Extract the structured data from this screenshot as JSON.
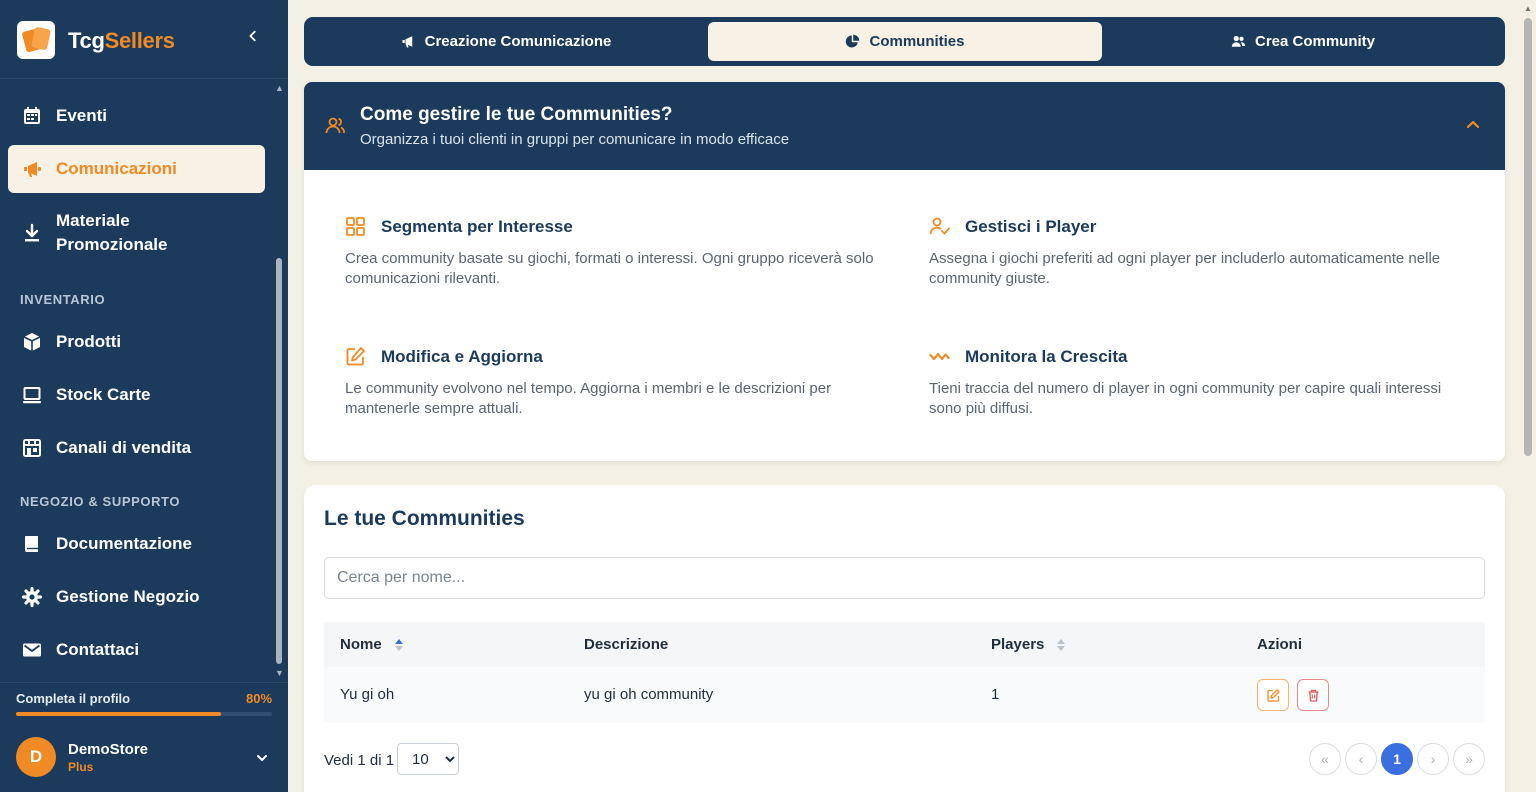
{
  "brand": {
    "name_part1": "Tcg",
    "name_part2": "Sellers"
  },
  "sidebar": {
    "collapse_icon": "chevron-left-icon",
    "items": [
      {
        "label": "Eventi",
        "icon": "calendar-icon",
        "active": false
      },
      {
        "label": "Comunicazioni",
        "icon": "megaphone-icon",
        "active": true
      },
      {
        "label": "Materiale Promozionale",
        "icon": "download-icon",
        "active": false
      },
      {
        "label": "Prodotti",
        "icon": "box-icon",
        "active": false
      },
      {
        "label": "Stock Carte",
        "icon": "monitor-icon",
        "active": false
      },
      {
        "label": "Canali di vendita",
        "icon": "store-icon",
        "active": false
      },
      {
        "label": "Documentazione",
        "icon": "book-icon",
        "active": false
      },
      {
        "label": "Gestione Negozio",
        "icon": "gear-icon",
        "active": false
      },
      {
        "label": "Contattaci",
        "icon": "mail-icon",
        "active": false
      }
    ],
    "sections": {
      "inventory": "INVENTARIO",
      "shop_support": "NEGOZIO & SUPPORTO"
    },
    "profile_progress": {
      "label": "Completa il profilo",
      "value_text": "80%",
      "fraction": 0.8
    },
    "user": {
      "initial": "D",
      "name": "DemoStore",
      "plan": "Plus"
    }
  },
  "tabs": [
    {
      "label": "Creazione Comunicazione",
      "icon": "megaphone-icon",
      "active": false
    },
    {
      "label": "Communities",
      "icon": "pie-chart-icon",
      "active": true
    },
    {
      "label": "Crea Community",
      "icon": "users-icon",
      "active": false
    }
  ],
  "info": {
    "title": "Come gestire le tue Communities?",
    "subtitle": "Organizza i tuoi clienti in gruppi per comunicare in modo efficace",
    "features": [
      {
        "title": "Segmenta per Interesse",
        "icon": "grid-icon",
        "desc": "Crea community basate su giochi, formati o interessi. Ogni gruppo riceverà solo comunicazioni rilevanti."
      },
      {
        "title": "Gestisci i Player",
        "icon": "user-check-icon",
        "desc": "Assegna i giochi preferiti ad ogni player per includerlo automaticamente nelle community giuste."
      },
      {
        "title": "Modifica e Aggiorna",
        "icon": "edit-icon",
        "desc": "Le community evolvono nel tempo. Aggiorna i membri e le descrizioni per mantenerle sempre attuali."
      },
      {
        "title": "Monitora la Crescita",
        "icon": "activity-icon",
        "desc": "Tieni traccia del numero di player in ogni community per capire quali interessi sono più diffusi."
      }
    ]
  },
  "communities": {
    "title": "Le tue Communities",
    "search_placeholder": "Cerca per nome...",
    "columns": [
      "Nome",
      "Descrizione",
      "Players",
      "Azioni"
    ],
    "rows": [
      {
        "name": "Yu gi oh",
        "description": "yu gi oh community",
        "players": "1"
      }
    ],
    "footer_label": "Vedi 1 di 1",
    "page_size": "10",
    "page_size_options": [
      "10"
    ],
    "current_page": "1"
  },
  "colors": {
    "navy": "#1b3a5c",
    "accent": "#f08a24",
    "cream": "#f8f1e5",
    "pagination": "#3b6fe0"
  }
}
